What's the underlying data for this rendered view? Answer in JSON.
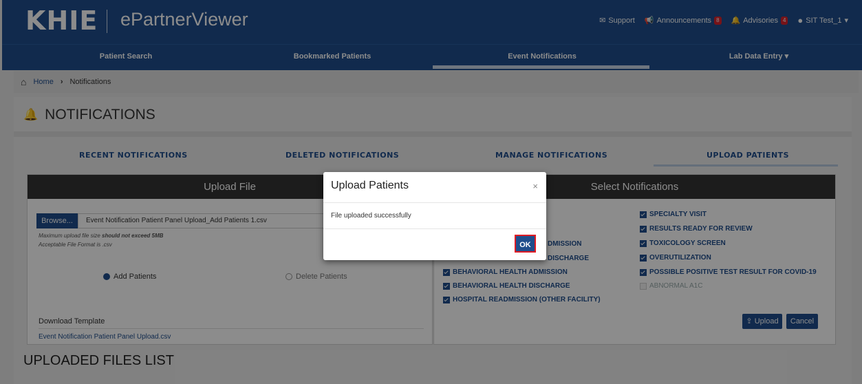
{
  "header": {
    "logo": "KHIE",
    "app_title": "ePartnerViewer",
    "links": {
      "support": "Support",
      "announcements": "Announcements",
      "announcements_count": "8",
      "advisories": "Advisories",
      "advisories_count": "4",
      "user": "SIT Test_1"
    }
  },
  "nav": {
    "items": [
      "Patient Search",
      "Bookmarked Patients",
      "Event Notifications",
      "Lab Data Entry"
    ]
  },
  "breadcrumb": {
    "home": "Home",
    "current": "Notifications"
  },
  "page": {
    "title": "NOTIFICATIONS",
    "tabs": [
      "RECENT NOTIFICATIONS",
      "DELETED NOTIFICATIONS",
      "MANAGE NOTIFICATIONS",
      "UPLOAD PATIENTS"
    ]
  },
  "upload_file": {
    "header": "Upload File",
    "browse_label": "Browse...",
    "file_value": "Event Notification Patient Panel Upload_Add Patients 1.csv",
    "hint_max_prefix": "Maximum upload file size ",
    "hint_max_bold": "should not exceed 5MB",
    "hint_format": "Acceptable File Format is .csv",
    "add_patients": "Add Patients",
    "delete_patients": "Delete Patients",
    "download_title": "Download Template",
    "download_link": "Event Notification Patient Panel Upload.csv"
  },
  "select_notifications": {
    "header": "Select Notifications",
    "col1_partial": [
      "DMISSION",
      "DISCHARGE"
    ],
    "col1": [
      "BEHAVIORAL HEALTH ADMISSION",
      "BEHAVIORAL HEALTH DISCHARGE",
      "HOSPITAL READMISSION (OTHER FACILITY)"
    ],
    "col2": [
      "SPECIALTY VISIT",
      "RESULTS READY FOR REVIEW",
      "TOXICOLOGY SCREEN",
      "OVERUTILIZATION",
      "POSSIBLE POSITIVE TEST RESULT FOR COVID-19"
    ],
    "col2_disabled": "ABNORMAL A1C",
    "upload_label": "Upload",
    "cancel_label": "Cancel"
  },
  "uploaded_list": {
    "title": "UPLOADED FILES LIST"
  },
  "modal": {
    "title": "Upload Patients",
    "close": "×",
    "body": "File uploaded successfully",
    "ok_label": "OK"
  },
  "colors": {
    "brand": "#1f4e8c",
    "highlight": "#e01b24"
  }
}
